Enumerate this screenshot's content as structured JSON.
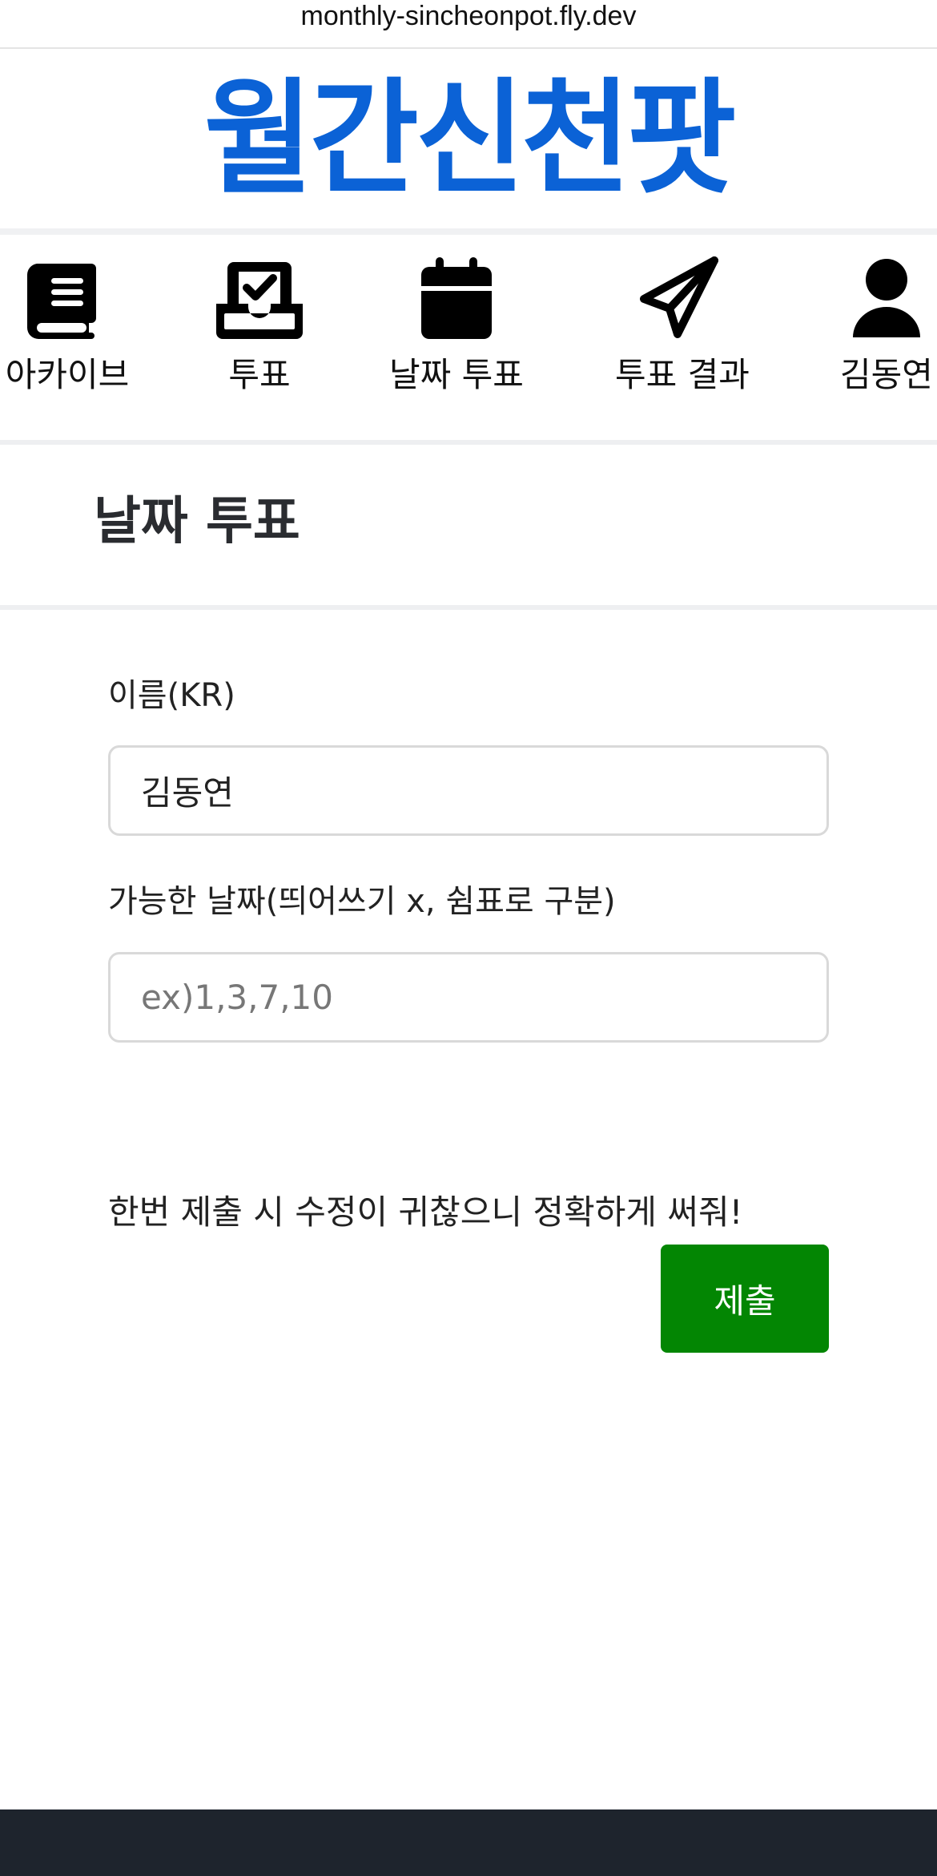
{
  "browser": {
    "url": "monthly-sincheonpot.fly.dev"
  },
  "header": {
    "logo": "월간신천팟",
    "logo_color": "#0b62d6"
  },
  "nav": {
    "items": [
      {
        "label": "아카이브",
        "icon": "book-icon"
      },
      {
        "label": "투표",
        "icon": "inbox-check-icon"
      },
      {
        "label": "날짜 투표",
        "icon": "calendar-icon"
      },
      {
        "label": "투표 결과",
        "icon": "paper-plane-icon"
      },
      {
        "label": "김동연",
        "icon": "user-icon"
      }
    ]
  },
  "page": {
    "title": "날짜 투표"
  },
  "form": {
    "name": {
      "label": "이름(KR)",
      "value": "김동연"
    },
    "dates": {
      "label": "가능한 날짜(띄어쓰기 x, 쉼표로 구분)",
      "placeholder": "ex)1,3,7,10",
      "value": ""
    },
    "note": "한번 제출 시 수정이 귀찮으니 정확하게 써줘!",
    "submit_label": "제출",
    "submit_color": "#038603"
  }
}
